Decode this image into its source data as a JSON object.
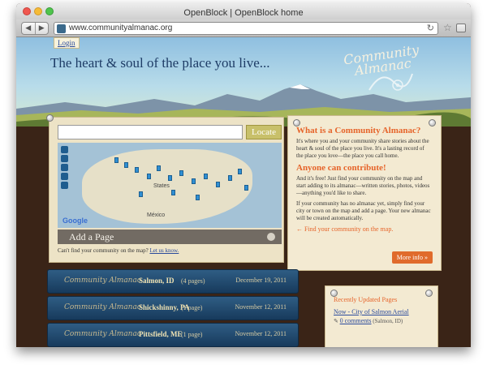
{
  "browser": {
    "window_title": "OpenBlock | OpenBlock home",
    "url": "www.communityalmanac.org",
    "back_icon": "◀",
    "forward_icon": "▶",
    "reload_icon": "↻",
    "star_icon": "☆"
  },
  "header": {
    "login_label": "Login",
    "tagline": "The heart & soul of the place you live...",
    "logo_line1": "Community",
    "logo_line2": "Almanac"
  },
  "map_panel": {
    "search_placeholder": "",
    "locate_label": "Locate",
    "map_labels": {
      "states": "States",
      "mexico": "México",
      "google": "Google"
    },
    "add_page_label": "Add a Page",
    "cant_find_text": "Can't find your community on the map?",
    "cant_find_link": "Let us know."
  },
  "info_panel": {
    "title": "What is a Community Almanac?",
    "para1": "It's where you and your community share stories about the heart & soul of the place you live. It's a lasting record of the place you love—the place you call home.",
    "subtitle": "Anyone can contribute!",
    "para2": "And it's free! Just find your community on the map and start adding to its almanac—written stories, photos, videos—anything you'd like to share.",
    "para3": "If your community has no almanac yet, simply find your city or town on the map and add a page. Your new almanac will be created automatically.",
    "find_link": "← Find your community on the map.",
    "more_info_label": "More info »"
  },
  "almanacs": [
    {
      "brand": "Community Almanac",
      "name": "Salmon, ID",
      "pages": "(4 pages)",
      "date": "December 19, 2011"
    },
    {
      "brand": "Community Almanac",
      "name": "Shickshinny, PA",
      "pages": "(1 page)",
      "date": "November 12, 2011"
    },
    {
      "brand": "Community Almanac",
      "name": "Pittsfield, ME",
      "pages": "(1 page)",
      "date": "November 12, 2011"
    }
  ],
  "recent_pages": {
    "title": "Recently Updated Pages",
    "item_title": "Now - City of Salmon Aerial",
    "comments": "0 comments",
    "location": "(Salmon, ID)"
  }
}
